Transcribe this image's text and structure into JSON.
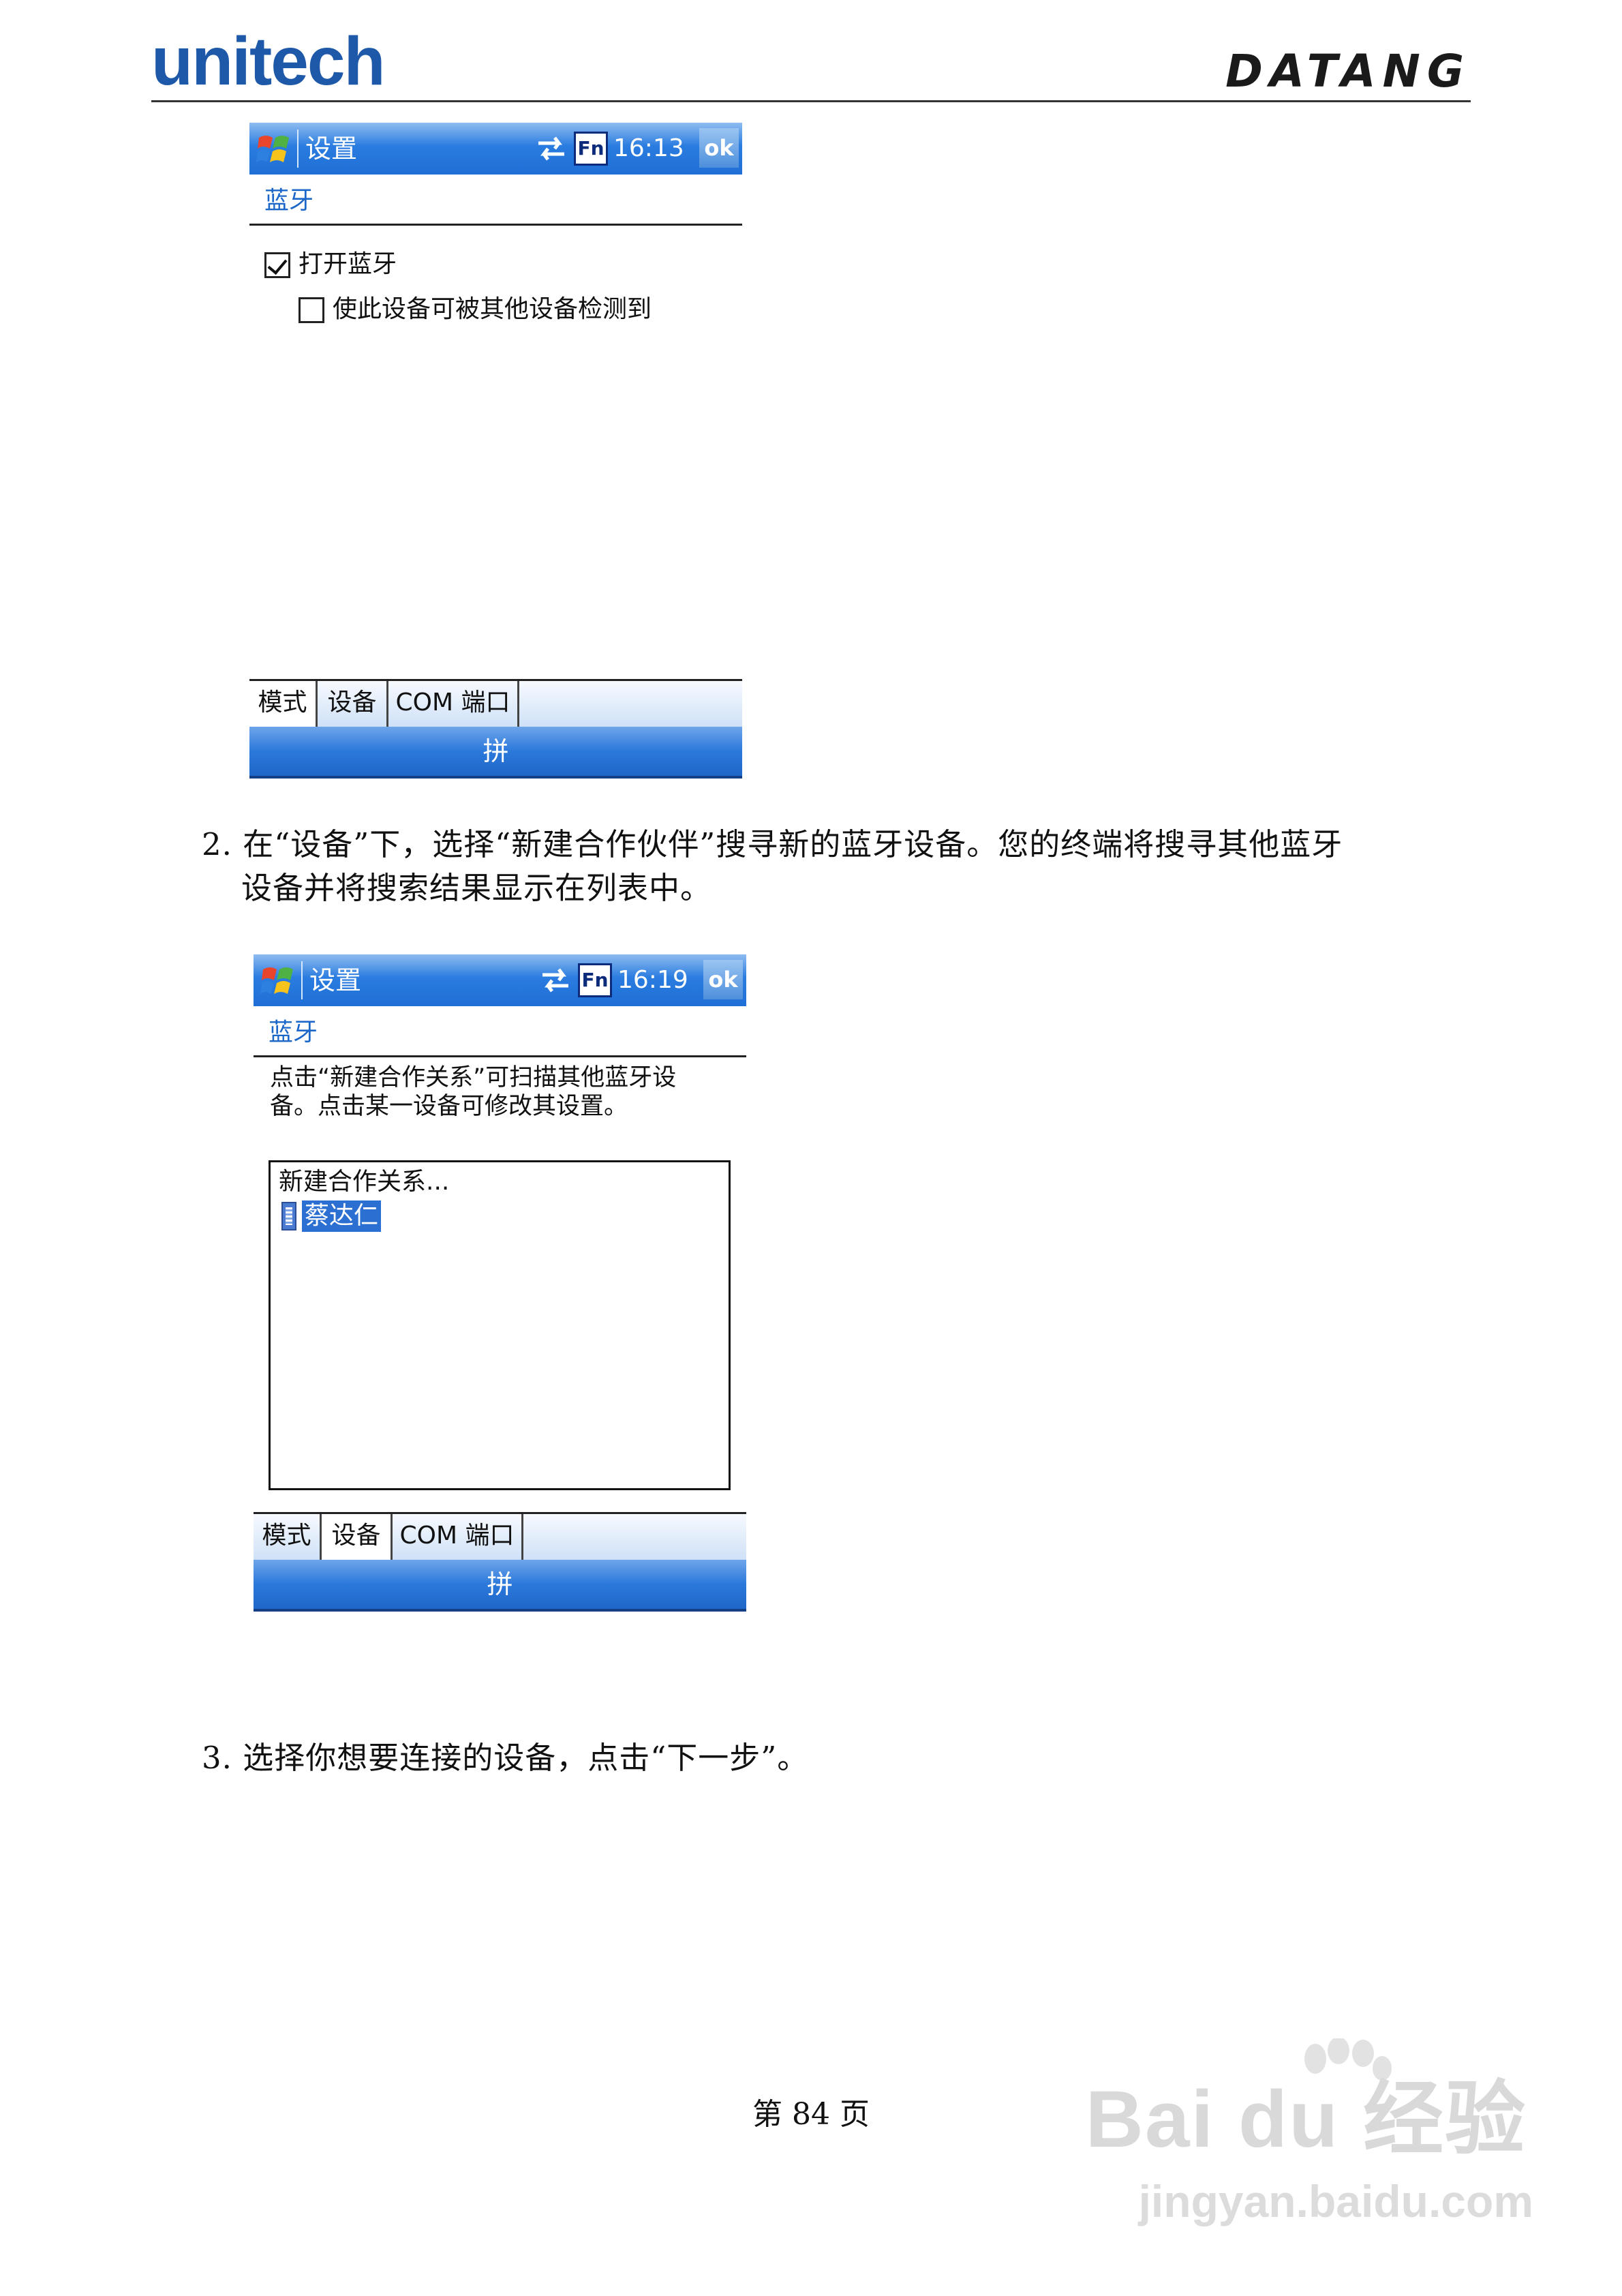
{
  "header": {
    "brand_left": "unitech",
    "brand_right": "DATANG"
  },
  "screen1": {
    "title": "设置",
    "time": "16:13",
    "fn_label": "Fn",
    "ok_label": "ok",
    "subheading": "蓝牙",
    "options": [
      {
        "label": "打开蓝牙",
        "checked": true
      },
      {
        "label": "使此设备可被其他设备检测到",
        "checked": false
      }
    ],
    "tabs": [
      {
        "label": "模式",
        "active": true
      },
      {
        "label": "设备",
        "active": false
      },
      {
        "label": "COM 端口",
        "active": false
      }
    ],
    "input_method": "拼"
  },
  "step2": {
    "line1": "2. 在“设备”下，选择“新建合作伙伴”搜寻新的蓝牙设备。您的终端将搜寻其他蓝牙",
    "line2": "设备并将搜索结果显示在列表中。"
  },
  "screen2": {
    "title": "设置",
    "time": "16:19",
    "fn_label": "Fn",
    "ok_label": "ok",
    "subheading": "蓝牙",
    "instruction_line1": "点击“新建合作关系”可扫描其他蓝牙设",
    "instruction_line2": "备。点击某一设备可修改其设置。",
    "list_items": [
      {
        "label": "新建合作关系...",
        "selected": false
      },
      {
        "label": "蔡达仁",
        "selected": true,
        "icon": "bluetooth-device-icon"
      }
    ],
    "tabs": [
      {
        "label": "模式",
        "active": false
      },
      {
        "label": "设备",
        "active": true
      },
      {
        "label": "COM 端口",
        "active": false
      }
    ],
    "input_method": "拼"
  },
  "step3": {
    "line1": "3. 选择你想要连接的设备，点击“下一步”。"
  },
  "footer": {
    "page": "第 84 页"
  },
  "watermark": {
    "line1": "Bai du 经验",
    "line2": "jingyan.baidu.com"
  },
  "colors": {
    "brand_blue": "#1e58a8",
    "titlebar_blue": "#2a7ce0",
    "subheading_blue": "#1a66c9",
    "selection_blue": "#2a6fd1"
  }
}
